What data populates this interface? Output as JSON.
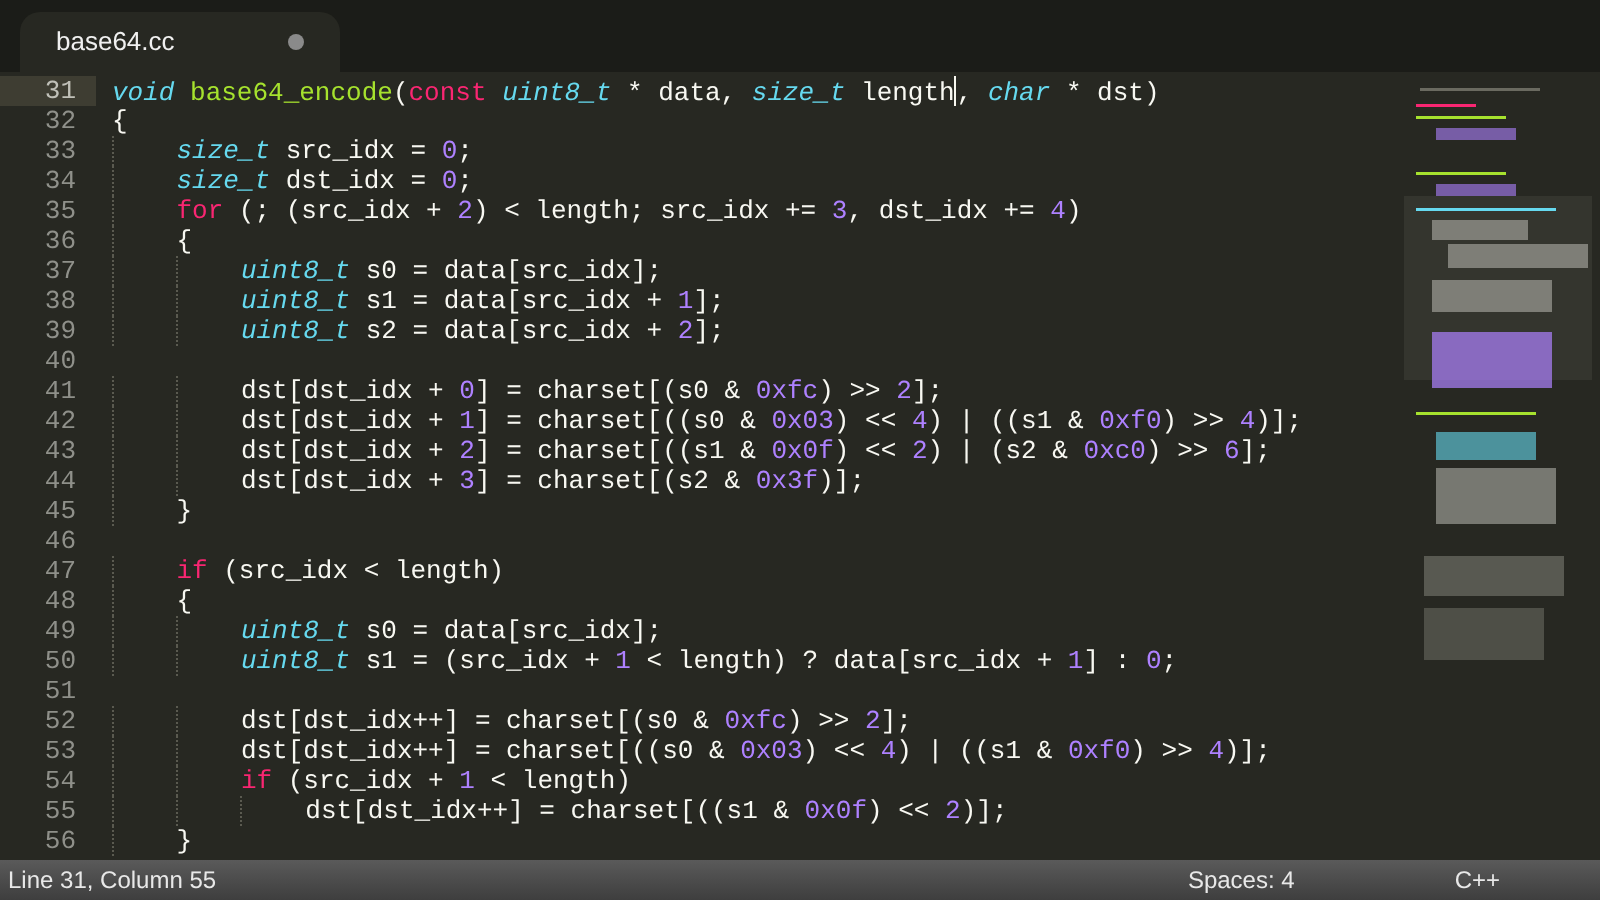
{
  "tab": {
    "title": "base64.cc",
    "modified": true,
    "selected": true
  },
  "lines": [
    {
      "number": "31",
      "current": true,
      "tokens": [
        {
          "kind": "type",
          "text": "void"
        },
        {
          "kind": "fn",
          "text": " base64_encode"
        },
        {
          "kind": "plain",
          "text": "("
        },
        {
          "kind": "kw",
          "text": "const"
        },
        {
          "kind": "type",
          "text": " uint8_t"
        },
        {
          "kind": "plain",
          "text": " * data, "
        },
        {
          "kind": "type",
          "text": "size_t"
        },
        {
          "kind": "plain",
          "text": " length",
          "cursor": true
        },
        {
          "kind": "plain",
          "text": ", "
        },
        {
          "kind": "type",
          "text": "char"
        },
        {
          "kind": "plain",
          "text": " * dst)"
        }
      ]
    },
    {
      "number": "32",
      "current": false,
      "tokens": [
        {
          "kind": "plain",
          "text": "{"
        }
      ]
    },
    {
      "number": "33",
      "current": false,
      "tokens": [
        {
          "kind": "type",
          "text": "    size_t"
        },
        {
          "kind": "plain",
          "text": " src_idx = "
        },
        {
          "kind": "num",
          "text": "0"
        },
        {
          "kind": "plain",
          "text": ";"
        }
      ]
    },
    {
      "number": "34",
      "current": false,
      "tokens": [
        {
          "kind": "type",
          "text": "    size_t"
        },
        {
          "kind": "plain",
          "text": " dst_idx = "
        },
        {
          "kind": "num",
          "text": "0"
        },
        {
          "kind": "plain",
          "text": ";"
        }
      ]
    },
    {
      "number": "35",
      "current": false,
      "tokens": [
        {
          "kind": "kw",
          "text": "    for"
        },
        {
          "kind": "plain",
          "text": " (; (src_idx + "
        },
        {
          "kind": "num",
          "text": "2"
        },
        {
          "kind": "plain",
          "text": ") < length; src_idx += "
        },
        {
          "kind": "num",
          "text": "3"
        },
        {
          "kind": "plain",
          "text": ", dst_idx += "
        },
        {
          "kind": "num",
          "text": "4"
        },
        {
          "kind": "plain",
          "text": ")"
        }
      ]
    },
    {
      "number": "36",
      "current": false,
      "tokens": [
        {
          "kind": "plain",
          "text": "    {"
        }
      ]
    },
    {
      "number": "37",
      "current": false,
      "tokens": [
        {
          "kind": "type",
          "text": "        uint8_t"
        },
        {
          "kind": "plain",
          "text": " s0 = data[src_idx];"
        }
      ]
    },
    {
      "number": "38",
      "current": false,
      "tokens": [
        {
          "kind": "type",
          "text": "        uint8_t"
        },
        {
          "kind": "plain",
          "text": " s1 = data[src_idx + "
        },
        {
          "kind": "num",
          "text": "1"
        },
        {
          "kind": "plain",
          "text": "];"
        }
      ]
    },
    {
      "number": "39",
      "current": false,
      "tokens": [
        {
          "kind": "type",
          "text": "        uint8_t"
        },
        {
          "kind": "plain",
          "text": " s2 = data[src_idx + "
        },
        {
          "kind": "num",
          "text": "2"
        },
        {
          "kind": "plain",
          "text": "];"
        }
      ]
    },
    {
      "number": "40",
      "current": false
    },
    {
      "number": "41",
      "current": false,
      "tokens": [
        {
          "kind": "plain",
          "text": "        dst[dst_idx + "
        },
        {
          "kind": "num",
          "text": "0"
        },
        {
          "kind": "plain",
          "text": "] = charset[(s0 & "
        },
        {
          "kind": "num",
          "text": "0xfc"
        },
        {
          "kind": "plain",
          "text": ") >> "
        },
        {
          "kind": "num",
          "text": "2"
        },
        {
          "kind": "plain",
          "text": "];"
        }
      ]
    },
    {
      "number": "42",
      "current": false,
      "tokens": [
        {
          "kind": "plain",
          "text": "        dst[dst_idx + "
        },
        {
          "kind": "num",
          "text": "1"
        },
        {
          "kind": "plain",
          "text": "] = charset[((s0 & "
        },
        {
          "kind": "num",
          "text": "0x03"
        },
        {
          "kind": "plain",
          "text": ") << "
        },
        {
          "kind": "num",
          "text": "4"
        },
        {
          "kind": "plain",
          "text": ") | ((s1 & "
        },
        {
          "kind": "num",
          "text": "0xf0"
        },
        {
          "kind": "plain",
          "text": ") >> "
        },
        {
          "kind": "num",
          "text": "4"
        },
        {
          "kind": "plain",
          "text": ")];"
        }
      ]
    },
    {
      "number": "43",
      "current": false,
      "tokens": [
        {
          "kind": "plain",
          "text": "        dst[dst_idx + "
        },
        {
          "kind": "num",
          "text": "2"
        },
        {
          "kind": "plain",
          "text": "] = charset[((s1 & "
        },
        {
          "kind": "num",
          "text": "0x0f"
        },
        {
          "kind": "plain",
          "text": ") << "
        },
        {
          "kind": "num",
          "text": "2"
        },
        {
          "kind": "plain",
          "text": ") | (s2 & "
        },
        {
          "kind": "num",
          "text": "0xc0"
        },
        {
          "kind": "plain",
          "text": ") >> "
        },
        {
          "kind": "num",
          "text": "6"
        },
        {
          "kind": "plain",
          "text": "];"
        }
      ]
    },
    {
      "number": "44",
      "current": false,
      "tokens": [
        {
          "kind": "plain",
          "text": "        dst[dst_idx + "
        },
        {
          "kind": "num",
          "text": "3"
        },
        {
          "kind": "plain",
          "text": "] = charset[(s2 & "
        },
        {
          "kind": "num",
          "text": "0x3f"
        },
        {
          "kind": "plain",
          "text": ")];"
        }
      ]
    },
    {
      "number": "45",
      "current": false,
      "tokens": [
        {
          "kind": "plain",
          "text": "    }"
        }
      ]
    },
    {
      "number": "46",
      "current": false
    },
    {
      "number": "47",
      "current": false,
      "tokens": [
        {
          "kind": "kw",
          "text": "    if"
        },
        {
          "kind": "plain",
          "text": " (src_idx < length)"
        }
      ]
    },
    {
      "number": "48",
      "current": false,
      "tokens": [
        {
          "kind": "plain",
          "text": "    {"
        }
      ]
    },
    {
      "number": "49",
      "current": false,
      "tokens": [
        {
          "kind": "type",
          "text": "        uint8_t"
        },
        {
          "kind": "plain",
          "text": " s0 = data[src_idx];"
        }
      ]
    },
    {
      "number": "50",
      "current": false,
      "tokens": [
        {
          "kind": "type",
          "text": "        uint8_t"
        },
        {
          "kind": "plain",
          "text": " s1 = (src_idx + "
        },
        {
          "kind": "num",
          "text": "1"
        },
        {
          "kind": "plain",
          "text": " < length) ? data[src_idx + "
        },
        {
          "kind": "num",
          "text": "1"
        },
        {
          "kind": "plain",
          "text": "] : "
        },
        {
          "kind": "num",
          "text": "0"
        },
        {
          "kind": "plain",
          "text": ";"
        }
      ]
    },
    {
      "number": "51",
      "current": false
    },
    {
      "number": "52",
      "current": false,
      "tokens": [
        {
          "kind": "plain",
          "text": "        dst[dst_idx++] = charset[(s0 & "
        },
        {
          "kind": "num",
          "text": "0xfc"
        },
        {
          "kind": "plain",
          "text": ") >> "
        },
        {
          "kind": "num",
          "text": "2"
        },
        {
          "kind": "plain",
          "text": "];"
        }
      ]
    },
    {
      "number": "53",
      "current": false,
      "tokens": [
        {
          "kind": "plain",
          "text": "        dst[dst_idx++] = charset[((s0 & "
        },
        {
          "kind": "num",
          "text": "0x03"
        },
        {
          "kind": "plain",
          "text": ") << "
        },
        {
          "kind": "num",
          "text": "4"
        },
        {
          "kind": "plain",
          "text": ") | ((s1 & "
        },
        {
          "kind": "num",
          "text": "0xf0"
        },
        {
          "kind": "plain",
          "text": ") >> "
        },
        {
          "kind": "num",
          "text": "4"
        },
        {
          "kind": "plain",
          "text": ")];"
        }
      ]
    },
    {
      "number": "54",
      "current": false,
      "tokens": [
        {
          "kind": "kw",
          "text": "        if"
        },
        {
          "kind": "plain",
          "text": " (src_idx + "
        },
        {
          "kind": "num",
          "text": "1"
        },
        {
          "kind": "plain",
          "text": " < length)"
        }
      ]
    },
    {
      "number": "55",
      "current": false,
      "tokens": [
        {
          "kind": "plain",
          "text": "            dst[dst_idx++] = charset[((s1 & "
        },
        {
          "kind": "num",
          "text": "0x0f"
        },
        {
          "kind": "plain",
          "text": ") << "
        },
        {
          "kind": "num",
          "text": "2"
        },
        {
          "kind": "plain",
          "text": ")];"
        }
      ]
    },
    {
      "number": "56",
      "current": false,
      "tokens": [
        {
          "kind": "plain",
          "text": "    }"
        }
      ]
    }
  ],
  "status_bar": {
    "position": "Line 31, Column 55",
    "indentation": "Spaces: 4",
    "syntax": "C++"
  }
}
